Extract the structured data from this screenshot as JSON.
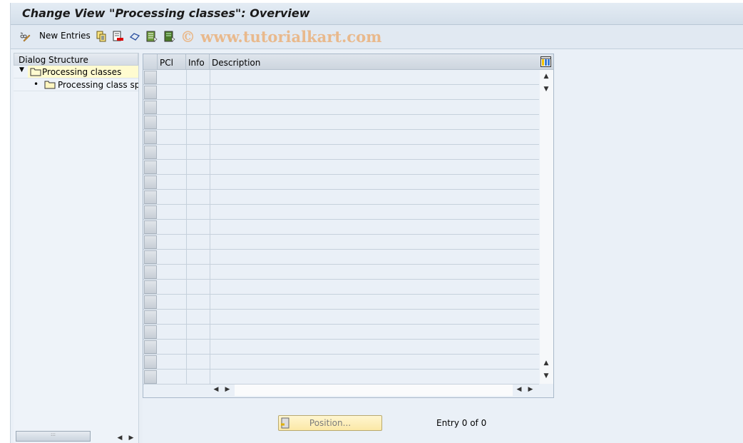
{
  "title": "Change View \"Processing classes\": Overview",
  "toolbar": {
    "new_entries": "New Entries",
    "watermark": "© www.tutorialkart.com",
    "icons": [
      "edit-glasses-icon",
      "copy-icon",
      "delete-icon",
      "undo-icon",
      "select-all-icon",
      "select-block-icon"
    ]
  },
  "dialog": {
    "header": "Dialog Structure",
    "items": [
      {
        "label": "Processing classes",
        "selected": true,
        "expanded": true
      },
      {
        "label": "Processing class spec"
      }
    ]
  },
  "table": {
    "columns": [
      "PCl",
      "Info",
      "Description"
    ],
    "rows": 21
  },
  "footer": {
    "position": "Position...",
    "entry": "Entry 0 of 0"
  },
  "colors": {
    "selected": "#fffbd0",
    "accent": "#e9b98c"
  }
}
